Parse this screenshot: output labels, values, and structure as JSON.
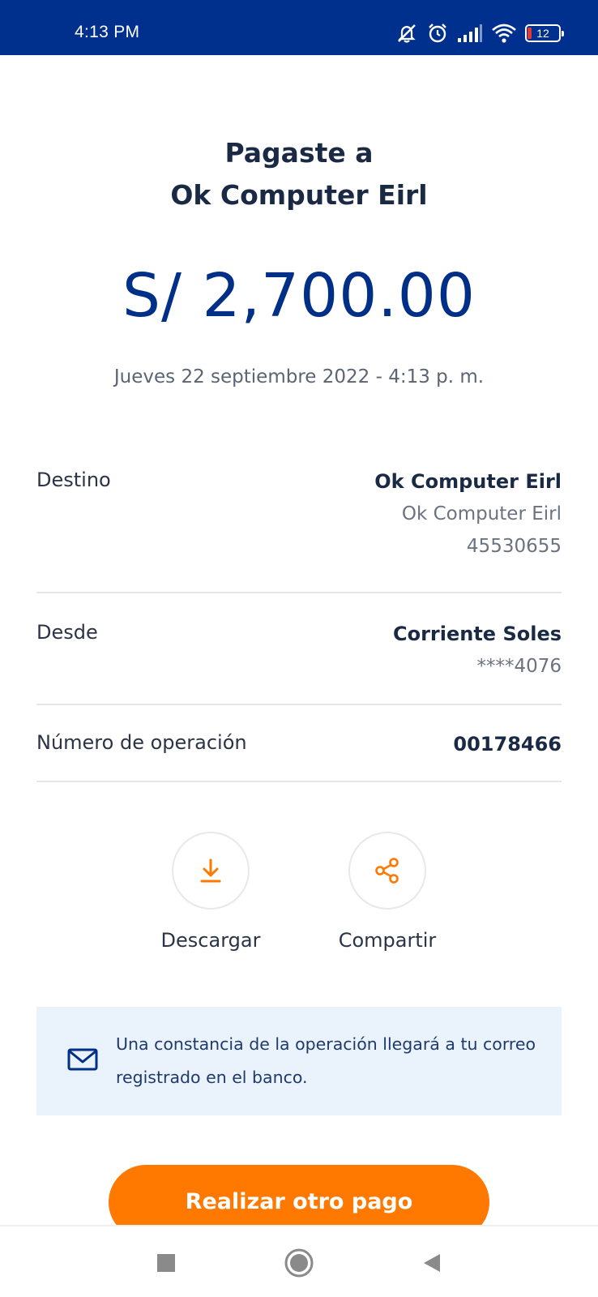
{
  "status_bar": {
    "time": "4:13 PM",
    "icons": [
      "bell-off-icon",
      "alarm-icon",
      "signal-icon",
      "wifi-icon"
    ],
    "battery": "12"
  },
  "header": {
    "line1": "Pagaste a",
    "line2": "Ok Computer Eirl"
  },
  "amount": "S/ 2,700.00",
  "date": "Jueves 22 septiembre 2022 - 4:13 p. m.",
  "details": {
    "destino": {
      "label": "Destino",
      "name": "Ok Computer Eirl",
      "subname": "Ok Computer Eirl",
      "number": "45530655"
    },
    "desde": {
      "label": "Desde",
      "account": "Corriente Soles",
      "masked": "****4076"
    },
    "operacion": {
      "label": "Número de operación",
      "value": "00178466"
    }
  },
  "actions": {
    "download": "Descargar",
    "share": "Compartir"
  },
  "info": {
    "text": "Una constancia de la operación llegará a tu correo registrado en el banco."
  },
  "primary_button": "Realizar otro pago",
  "colors": {
    "brand_blue": "#002f87",
    "accent_orange": "#ff7800",
    "info_bg": "#eaf2fb"
  }
}
